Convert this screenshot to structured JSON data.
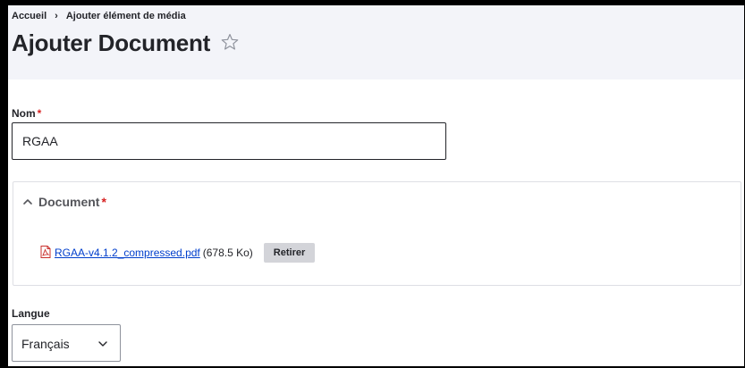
{
  "breadcrumb": {
    "home": "Accueil",
    "separator": "›",
    "current": "Ajouter élément de média"
  },
  "header": {
    "title": "Ajouter Document",
    "favorite_icon": "star-outline-icon"
  },
  "form": {
    "name": {
      "label": "Nom",
      "required_mark": "*",
      "value": "RGAA"
    },
    "document": {
      "label": "Document",
      "required_mark": "*",
      "toggle_icon": "chevron-up-icon",
      "file_icon": "pdf-file-icon",
      "file_name": "RGAA-v4.1.2_compressed.pdf",
      "file_size": "(678.5 Ko)",
      "remove_label": "Retirer"
    },
    "language": {
      "label": "Langue",
      "value": "Français",
      "toggle_icon": "chevron-down-icon"
    }
  },
  "colors": {
    "header_bg": "#f3f4f9",
    "required": "#d72222",
    "link": "#003ecc",
    "button_bg": "#d3d4d9",
    "text": "#232429"
  }
}
